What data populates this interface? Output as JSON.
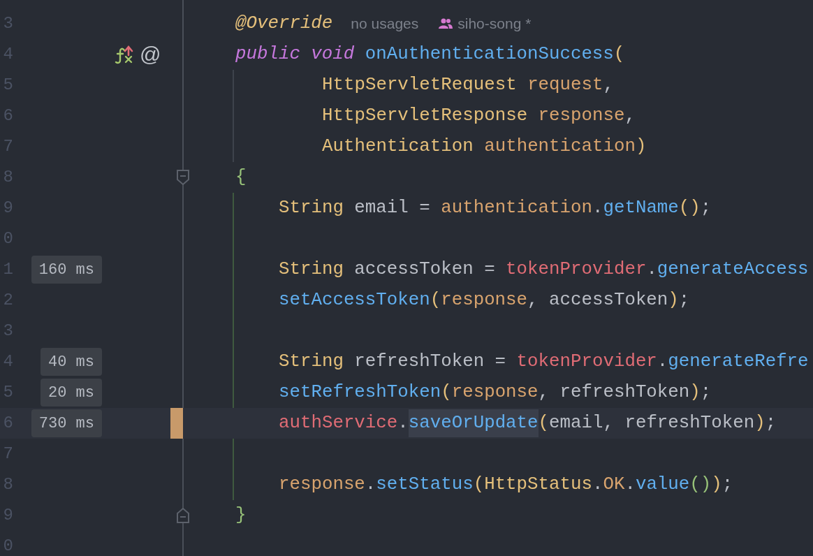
{
  "editor": {
    "lines": [
      {
        "number": "3",
        "kind": "declaration",
        "tokens": [
          {
            "text": "@Override",
            "kind": "ann"
          }
        ],
        "inlays": [
          {
            "kind": "usages",
            "text": "no usages"
          },
          {
            "kind": "author",
            "text": "siho-song *"
          }
        ]
      },
      {
        "number": "4",
        "kind": "declaration",
        "gutter_icons": [
          {
            "kind": "overrides"
          },
          {
            "kind": "annotation",
            "glyph": "@"
          }
        ],
        "tokens": [
          {
            "text": "public",
            "kind": "kw"
          },
          {
            "text": " void",
            "kind": "kw"
          },
          {
            "text": " onAuthenticationSuccess",
            "kind": "fn"
          },
          {
            "text": "(",
            "kind": "paren"
          }
        ]
      },
      {
        "number": "5",
        "kind": "continuation",
        "tokens": [
          {
            "text": "HttpServletRequest",
            "kind": "type"
          },
          {
            "text": " request",
            "kind": "param"
          },
          {
            "text": ",",
            "kind": "punct"
          }
        ]
      },
      {
        "number": "6",
        "kind": "continuation",
        "tokens": [
          {
            "text": "HttpServletResponse",
            "kind": "type"
          },
          {
            "text": " response",
            "kind": "param"
          },
          {
            "text": ",",
            "kind": "punct"
          }
        ]
      },
      {
        "number": "7",
        "kind": "continuation",
        "tokens": [
          {
            "text": "Authentication",
            "kind": "type"
          },
          {
            "text": " authentication",
            "kind": "param"
          },
          {
            "text": ")",
            "kind": "paren"
          }
        ]
      },
      {
        "number": "8",
        "kind": "declaration",
        "fold_start": true,
        "tokens": [
          {
            "text": "{",
            "kind": "brace"
          }
        ]
      },
      {
        "number": "9",
        "kind": "body",
        "tokens": [
          {
            "text": "String",
            "kind": "type"
          },
          {
            "text": " email",
            "kind": "var"
          },
          {
            "text": " =",
            "kind": "punct"
          },
          {
            "text": " authentication",
            "kind": "param"
          },
          {
            "text": ".",
            "kind": "punct"
          },
          {
            "text": "getName",
            "kind": "call"
          },
          {
            "text": "()",
            "kind": "paren"
          },
          {
            "text": ";",
            "kind": "punct"
          }
        ]
      },
      {
        "number": "0",
        "kind": "blank"
      },
      {
        "number": "1",
        "kind": "body",
        "timing": "160 ms",
        "tokens": [
          {
            "text": "String",
            "kind": "type"
          },
          {
            "text": " accessToken",
            "kind": "var"
          },
          {
            "text": " =",
            "kind": "punct"
          },
          {
            "text": " tokenProvider",
            "kind": "field"
          },
          {
            "text": ".",
            "kind": "punct"
          },
          {
            "text": "generateAccess",
            "kind": "call"
          }
        ]
      },
      {
        "number": "2",
        "kind": "body",
        "tokens": [
          {
            "text": "setAccessToken",
            "kind": "call"
          },
          {
            "text": "(",
            "kind": "paren"
          },
          {
            "text": "response",
            "kind": "param"
          },
          {
            "text": ",",
            "kind": "punct"
          },
          {
            "text": " accessToken",
            "kind": "var"
          },
          {
            "text": ")",
            "kind": "paren"
          },
          {
            "text": ";",
            "kind": "punct"
          }
        ]
      },
      {
        "number": "3",
        "kind": "blank"
      },
      {
        "number": "4",
        "kind": "body",
        "timing": "40 ms",
        "tokens": [
          {
            "text": "String",
            "kind": "type"
          },
          {
            "text": " refreshToken",
            "kind": "var"
          },
          {
            "text": " =",
            "kind": "punct"
          },
          {
            "text": " tokenProvider",
            "kind": "field"
          },
          {
            "text": ".",
            "kind": "punct"
          },
          {
            "text": "generateRefre",
            "kind": "call"
          }
        ]
      },
      {
        "number": "5",
        "kind": "body",
        "timing": "20 ms",
        "tokens": [
          {
            "text": "setRefreshToken",
            "kind": "call"
          },
          {
            "text": "(",
            "kind": "paren"
          },
          {
            "text": "response",
            "kind": "param"
          },
          {
            "text": ",",
            "kind": "punct"
          },
          {
            "text": " refreshToken",
            "kind": "var"
          },
          {
            "text": ")",
            "kind": "paren"
          },
          {
            "text": ";",
            "kind": "punct"
          }
        ]
      },
      {
        "number": "6",
        "kind": "body",
        "timing": "730 ms",
        "current": true,
        "changed": true,
        "tokens": [
          {
            "text": "authService",
            "kind": "field"
          },
          {
            "text": ".",
            "kind": "punct"
          },
          {
            "text": "saveOrUpdate",
            "kind": "call",
            "highlighted": true
          },
          {
            "text": "(",
            "kind": "paren"
          },
          {
            "text": "email",
            "kind": "var"
          },
          {
            "text": ",",
            "kind": "punct"
          },
          {
            "text": " refreshToken",
            "kind": "var"
          },
          {
            "text": ")",
            "kind": "paren"
          },
          {
            "text": ";",
            "kind": "punct"
          }
        ]
      },
      {
        "number": "7",
        "kind": "blank"
      },
      {
        "number": "8",
        "kind": "body",
        "tokens": [
          {
            "text": "response",
            "kind": "param"
          },
          {
            "text": ".",
            "kind": "punct"
          },
          {
            "text": "setStatus",
            "kind": "call"
          },
          {
            "text": "(",
            "kind": "paren"
          },
          {
            "text": "HttpStatus",
            "kind": "type"
          },
          {
            "text": ".",
            "kind": "punct"
          },
          {
            "text": "OK",
            "kind": "const"
          },
          {
            "text": ".",
            "kind": "punct"
          },
          {
            "text": "value",
            "kind": "call"
          },
          {
            "text": "()",
            "kind": "paren2"
          },
          {
            "text": ")",
            "kind": "paren"
          },
          {
            "text": ";",
            "kind": "punct"
          }
        ]
      },
      {
        "number": "9",
        "kind": "declaration",
        "fold_end": true,
        "tokens": [
          {
            "text": "}",
            "kind": "brace"
          }
        ]
      },
      {
        "number": "0",
        "kind": "blank"
      }
    ]
  }
}
